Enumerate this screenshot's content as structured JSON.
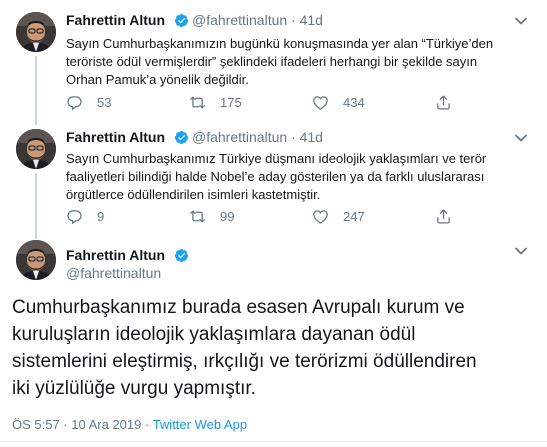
{
  "tweets": [
    {
      "name": "Fahrettin Altun",
      "handle": "@fahrettinaltun",
      "sep": "·",
      "time": "41d",
      "lines": [
        "Sayın Cumhurbaşkanımızın bugünkü konuşmasında yer alan “Türkiye’den",
        "teröriste ödül vermişlerdir” şeklindeki  ifadeleri herhangi bir şekilde sayın",
        "Orhan Pamuk’a yönelik değildir."
      ],
      "replies": "53",
      "retweets": "175",
      "likes": "434"
    },
    {
      "name": "Fahrettin Altun",
      "handle": "@fahrettinaltun",
      "sep": "·",
      "time": "41d",
      "lines": [
        "Sayın Cumhurbaşkanımız Türkiye düşmanı ideolojik yaklaşımları ve terör",
        "faaliyetleri bilindiği halde Nobel’e aday gösterilen ya da farklı uluslararası",
        "örgütlerce ödüllendirilen isimleri kastetmiştir."
      ],
      "replies": "9",
      "retweets": "99",
      "likes": "247"
    }
  ],
  "main": {
    "name": "Fahrettin Altun",
    "handle": "@fahrettinaltun",
    "lines": [
      "Cumhurbaşkanımız burada esasen  Avrupalı kurum ve",
      "kuruluşların ideolojik yaklaşımlara dayanan ödül",
      "sistemlerini eleştirmiş, ırkçılığı ve terörizmi ödüllendiren",
      "iki yüzlülüğe vurgu yapmıştır."
    ],
    "time": "ÖS 5:57 · 10 Ara 2019 · ",
    "source": "Twitter Web App"
  },
  "colors": {
    "accent": "#1da1f2",
    "secondary": "#657786",
    "text": "#14171a"
  },
  "icons": [
    "verified-badge-icon",
    "reply-icon",
    "retweet-icon",
    "like-icon",
    "share-icon",
    "caret-down-icon"
  ]
}
